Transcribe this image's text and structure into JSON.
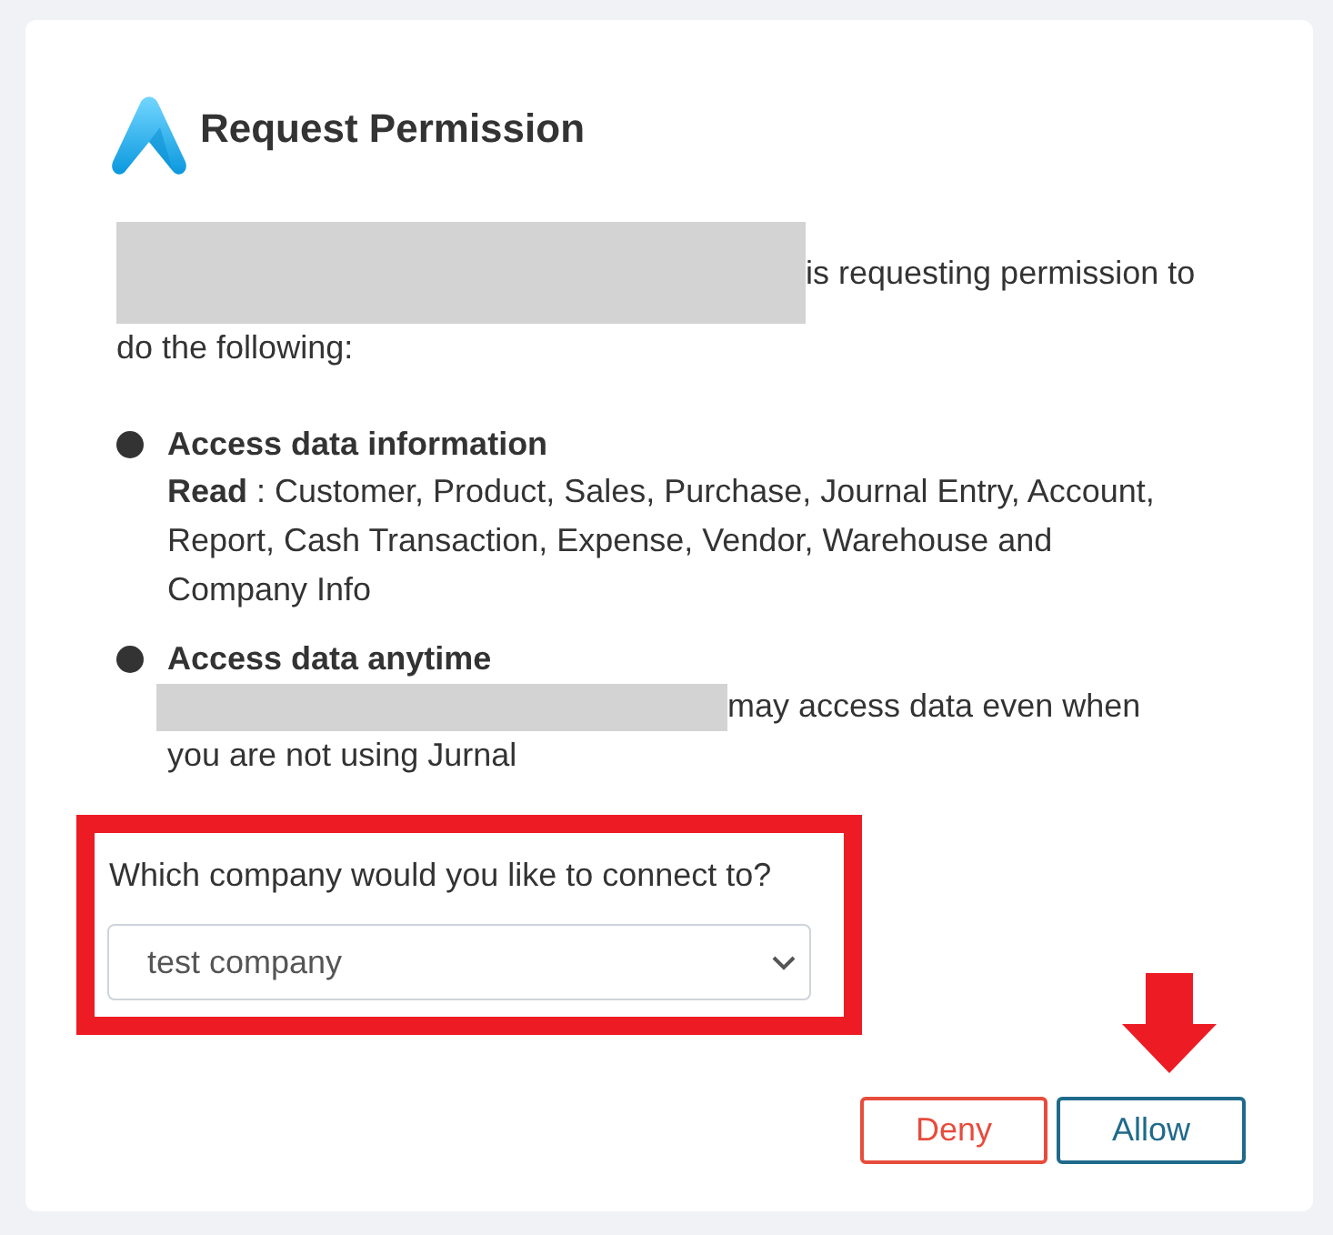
{
  "header": {
    "title": "Request Permission"
  },
  "intro": {
    "lines": [
      "is requesting permission to",
      "do the following:"
    ]
  },
  "permissions": [
    {
      "kind": "plain",
      "title": "Access data information",
      "body": "**Read** : Customer, Product, Sales, Purchase, Journal Entry, Account, Report, Cash Transaction, Expense, Vendor, Warehouse and Company Info"
    },
    {
      "kind": "redacted",
      "title": "Access data anytime",
      "lines": [
        "may access data even when",
        "you are not using Jurnal"
      ]
    }
  ],
  "company_select": {
    "label": "Which company would you like to connect to?",
    "value": "test company"
  },
  "buttons": [
    {
      "kind": "deny",
      "label": "Deny"
    },
    {
      "kind": "allow",
      "label": "Allow"
    }
  ]
}
